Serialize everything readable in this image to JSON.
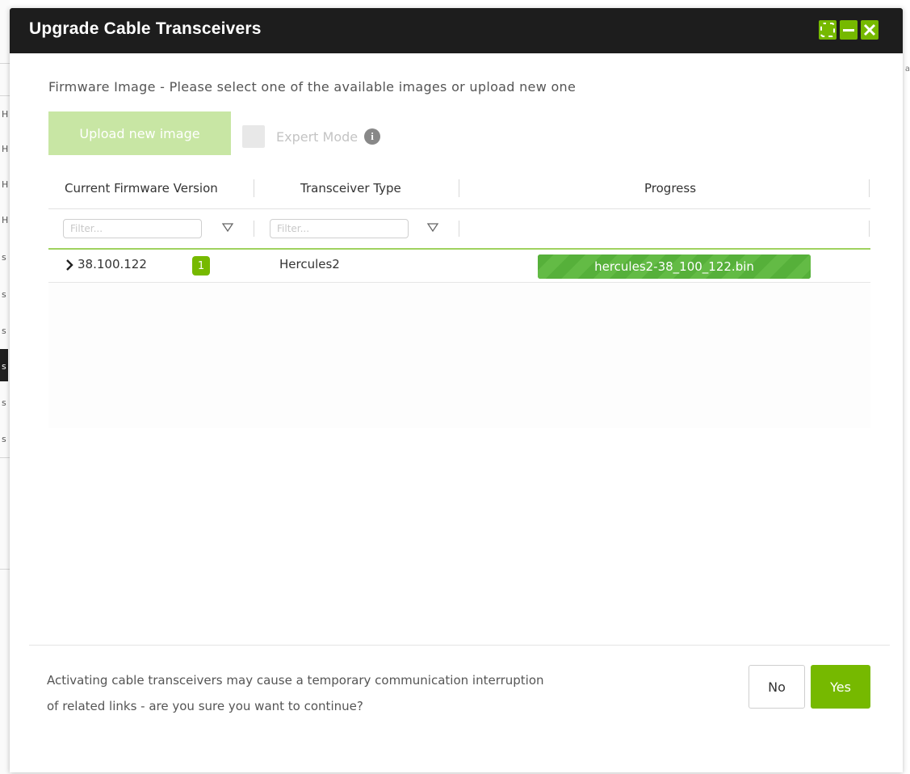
{
  "background": {
    "row_marks": [
      "H",
      "H",
      "H",
      "H",
      "s",
      "s",
      "s",
      "s",
      "s",
      "s"
    ],
    "right_mark": "a"
  },
  "dialog": {
    "title": "Upgrade Cable Transceivers",
    "window_buttons": [
      "maximize-icon",
      "minimize-icon",
      "close-icon"
    ],
    "subtitle": "Firmware Image - Please select one of the available images or upload new one",
    "upload_button_label": "Upload new image",
    "expert_mode_label": "Expert Mode",
    "info_glyph": "i"
  },
  "grid": {
    "columns": [
      "Current Firmware Version",
      "Transceiver Type",
      "Progress"
    ],
    "filter_placeholders": [
      "Filter...",
      "Filter..."
    ],
    "rows": [
      {
        "firmware_version": "38.100.122",
        "count": "1",
        "transceiver_type": "Hercules2",
        "progress_label": "hercules2-38_100_122.bin",
        "progress_fraction": 1.0
      }
    ]
  },
  "footer": {
    "message": "Activating cable transceivers may cause a temporary communication interruption of related links - are you sure you want to continue?",
    "no_label": "No",
    "yes_label": "Yes"
  },
  "colors": {
    "accent": "#76b900",
    "titlebar": "#1d1d1d",
    "upload_disabled": "#c8e6a4",
    "progress": "#56b03a"
  }
}
